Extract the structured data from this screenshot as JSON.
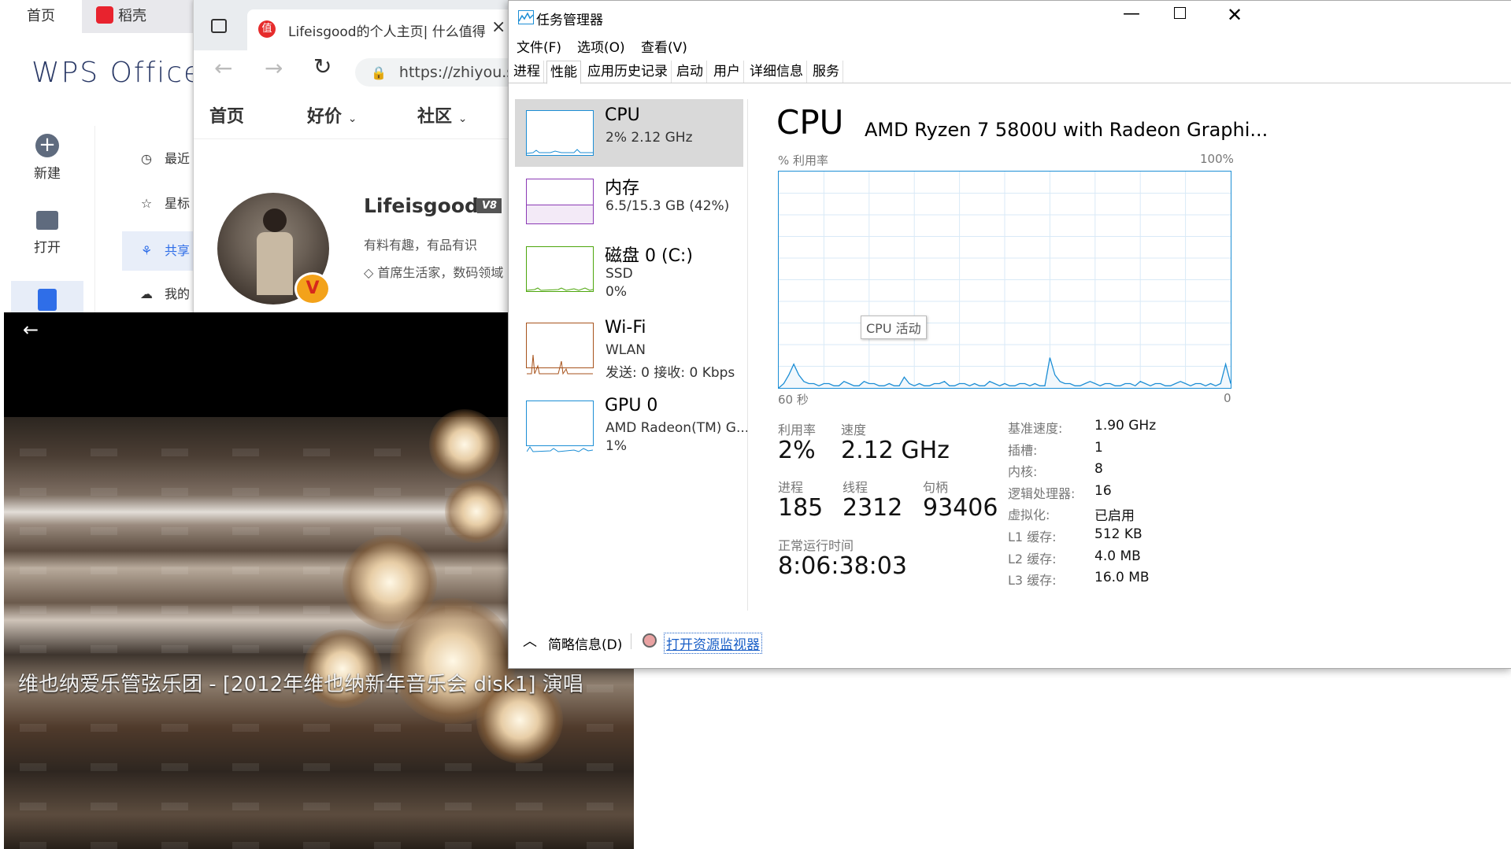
{
  "wps": {
    "tab_home": "首页",
    "tab_daoke": "稻壳",
    "logo": "WPS Office",
    "new_label": "新建",
    "open_label": "打开",
    "nav": [
      "最近",
      "星标",
      "共享",
      "我的"
    ]
  },
  "browser": {
    "tab_title": "Lifeisgood的个人主页| 什么值得",
    "url": "https://zhiyou.s",
    "menu": [
      "首页",
      "好价",
      "社区"
    ],
    "profile_name": "Lifeisgood",
    "level_badge": "V8",
    "tagline": "有料有趣，有品有识",
    "desc": "首席生活家，数码领域"
  },
  "video": {
    "title": "维也纳爱乐管弦乐团 - [2012年维也纳新年音乐会 disk1] 演唱"
  },
  "taskmgr": {
    "title": "任务管理器",
    "menu": [
      "文件(F)",
      "选项(O)",
      "查看(V)"
    ],
    "tabs": [
      "进程",
      "性能",
      "应用历史记录",
      "启动",
      "用户",
      "详细信息",
      "服务"
    ],
    "left_items": [
      {
        "name": "CPU",
        "sub1": "2%  2.12 GHz",
        "sub2": "",
        "sub3": ""
      },
      {
        "name": "内存",
        "sub1": "6.5/15.3 GB (42%)",
        "sub2": "",
        "sub3": ""
      },
      {
        "name": "磁盘 0 (C:)",
        "sub1": "SSD",
        "sub2": "0%",
        "sub3": ""
      },
      {
        "name": "Wi-Fi",
        "sub1": "WLAN",
        "sub2": "发送: 0  接收: 0 Kbps",
        "sub3": ""
      },
      {
        "name": "GPU 0",
        "sub1": "AMD Radeon(TM) G...",
        "sub2": "1%",
        "sub3": ""
      }
    ],
    "header_title": "CPU",
    "header_model": "AMD Ryzen 7 5800U with Radeon Graphi...",
    "chart_label_left": "% 利用率",
    "chart_label_right": "100%",
    "chart_time_left": "60 秒",
    "chart_time_right": "0",
    "chart_tooltip": "CPU 活动",
    "stats": {
      "util_label": "利用率",
      "util_value": "2%",
      "speed_label": "速度",
      "speed_value": "2.12 GHz",
      "proc_label": "进程",
      "proc_value": "185",
      "thread_label": "线程",
      "thread_value": "2312",
      "handle_label": "句柄",
      "handle_value": "93406",
      "uptime_label": "正常运行时间",
      "uptime_value": "8:06:38:03"
    },
    "specs": [
      {
        "k": "基准速度:",
        "v": "1.90 GHz"
      },
      {
        "k": "插槽:",
        "v": "1"
      },
      {
        "k": "内核:",
        "v": "8"
      },
      {
        "k": "逻辑处理器:",
        "v": "16"
      },
      {
        "k": "虚拟化:",
        "v": "已启用"
      },
      {
        "k": "L1 缓存:",
        "v": "512 KB"
      },
      {
        "k": "L2 缓存:",
        "v": "4.0 MB"
      },
      {
        "k": "L3 缓存:",
        "v": "16.0 MB"
      }
    ],
    "footer_summary": "简略信息(D)",
    "footer_monitor": "打开资源监视器",
    "cpu_history": [
      0,
      2,
      6,
      11,
      6,
      3,
      2,
      2,
      1,
      2,
      2,
      1,
      1,
      3,
      2,
      1,
      1,
      3,
      2,
      2,
      1,
      1,
      2,
      1,
      1,
      5,
      2,
      1,
      2,
      1,
      1,
      2,
      2,
      3,
      1,
      1,
      2,
      2,
      1,
      2,
      1,
      1,
      3,
      2,
      1,
      2,
      1,
      1,
      2,
      2,
      1,
      2,
      1,
      1,
      14,
      6,
      3,
      2,
      2,
      1,
      1,
      2,
      3,
      2,
      1,
      2,
      2,
      1,
      1,
      2,
      2,
      1,
      3,
      2,
      1,
      2,
      2,
      1,
      1,
      2,
      3,
      2,
      1,
      2,
      2,
      1,
      2,
      1,
      2,
      11,
      2
    ],
    "colors": {
      "cpu_line": "#1c8ed5",
      "mem_line": "#8b3ab5",
      "disk_line": "#4da60c",
      "wifi_line": "#a7531c",
      "gpu_line": "#1c8ed5"
    }
  }
}
